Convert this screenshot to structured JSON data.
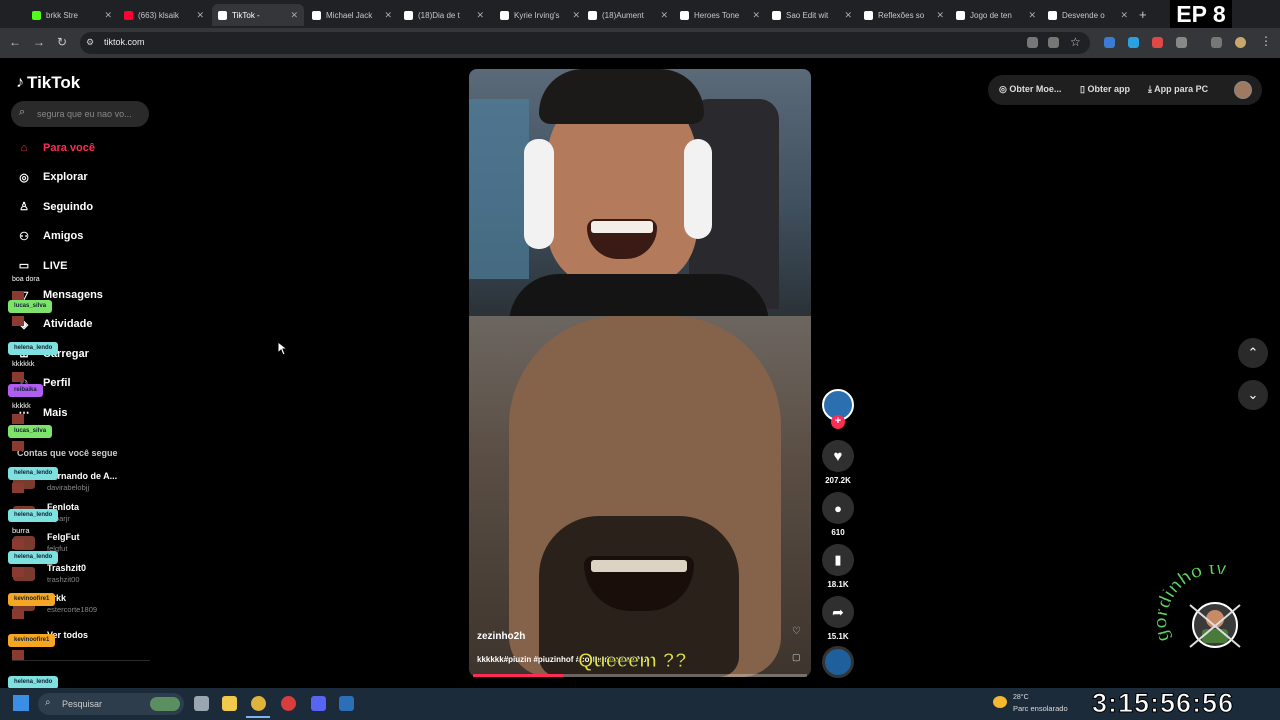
{
  "browser": {
    "tabs": [
      {
        "label": "brkk Stre",
        "color": "#53fc18"
      },
      {
        "label": "(663) klsaik",
        "color": "#ff0033"
      },
      {
        "label": "TikTok -",
        "color": "#ffffff",
        "active": true
      },
      {
        "label": "Michael Jack",
        "color": "#ffffff"
      },
      {
        "label": "(18)Dia de t",
        "color": "#ffffff"
      },
      {
        "label": "Kyrie Irving's",
        "color": "#ffffff"
      },
      {
        "label": "(18)Aument",
        "color": "#ffffff"
      },
      {
        "label": "Heroes Tone",
        "color": "#ffffff"
      },
      {
        "label": "Sao Edit wit",
        "color": "#ffffff"
      },
      {
        "label": "Reflexões so",
        "color": "#ffffff"
      },
      {
        "label": "Jogo de ten",
        "color": "#ffffff"
      },
      {
        "label": "Desvende o",
        "color": "#ffffff"
      }
    ],
    "new_tab": "+",
    "url": "tiktok.com"
  },
  "sidebar": {
    "logo": "TikTok",
    "search_placeholder": "segura que eu nao vo...",
    "nav": [
      {
        "label": "Para você",
        "icon": "home-icon",
        "active": true
      },
      {
        "label": "Explorar",
        "icon": "compass-icon"
      },
      {
        "label": "Seguindo",
        "icon": "following-icon"
      },
      {
        "label": "Amigos",
        "icon": "friends-icon"
      },
      {
        "label": "LIVE",
        "icon": "live-icon"
      },
      {
        "label": "Mensagens",
        "icon": "messages-icon"
      },
      {
        "label": "Atividade",
        "icon": "activity-icon"
      },
      {
        "label": "Carregar",
        "icon": "upload-icon"
      },
      {
        "label": "Perfil",
        "icon": "profile-icon"
      },
      {
        "label": "Mais",
        "icon": "more-icon"
      }
    ],
    "following_title": "Contas que você segue",
    "following": [
      {
        "name": "Fernando de A...",
        "handle": "davirabelobjj"
      },
      {
        "name": "Fenlota",
        "handle": "felparjr"
      },
      {
        "name": "FelgFut",
        "handle": "felgfut"
      },
      {
        "name": "Trashzit0",
        "handle": "trashzit00"
      },
      {
        "name": "brkk",
        "handle": "estercorte1809"
      }
    ],
    "see_all": "Ver todos"
  },
  "chat": [
    {
      "user": "boa dora",
      "msg": ""
    },
    {
      "user": "lucas_silva",
      "msg": "",
      "color": "#7de36b"
    },
    {
      "user": "helena_lendo",
      "msg": "kkkkkk",
      "color": "#7fe0e0"
    },
    {
      "user": "reibaika",
      "msg": "kkkkk",
      "color": "#b05ef0"
    },
    {
      "user": "lucas_silva",
      "msg": "",
      "color": "#7de36b"
    },
    {
      "user": "helena_lendo",
      "msg": "",
      "color": "#7fe0e0"
    },
    {
      "user": "helena_lendo",
      "msg": "burra",
      "color": "#7fe0e0"
    },
    {
      "user": "helena_lendo",
      "msg": "",
      "color": "#7fe0e0"
    },
    {
      "user": "kevinoofire1",
      "msg": "",
      "color": "#f5a623"
    },
    {
      "user": "kevinoofire1",
      "msg": "",
      "color": "#f5a623"
    },
    {
      "user": "helena_lendo",
      "msg": "",
      "color": "#7fe0e0"
    }
  ],
  "video": {
    "author": "zezinho2h",
    "caption": "kkkkkk#piuzin #piuzinhof #cortesdopiuzinho",
    "subtitle": "Queeem ??",
    "progress": 0.27
  },
  "actions": {
    "likes": "207.2K",
    "comments": "610",
    "saves": "18.1K",
    "shares": "15.1K"
  },
  "topbar": {
    "coins": "Obter Moe...",
    "get_app": "Obter app",
    "pc_app": "App para PC"
  },
  "taskbar": {
    "search": "Pesquisar",
    "temp": "28°C",
    "weather": "Parc ensolarado"
  },
  "stream": {
    "episode": "EP 8",
    "timer": "3:15:56:56",
    "watermark": "gordinho tv"
  }
}
